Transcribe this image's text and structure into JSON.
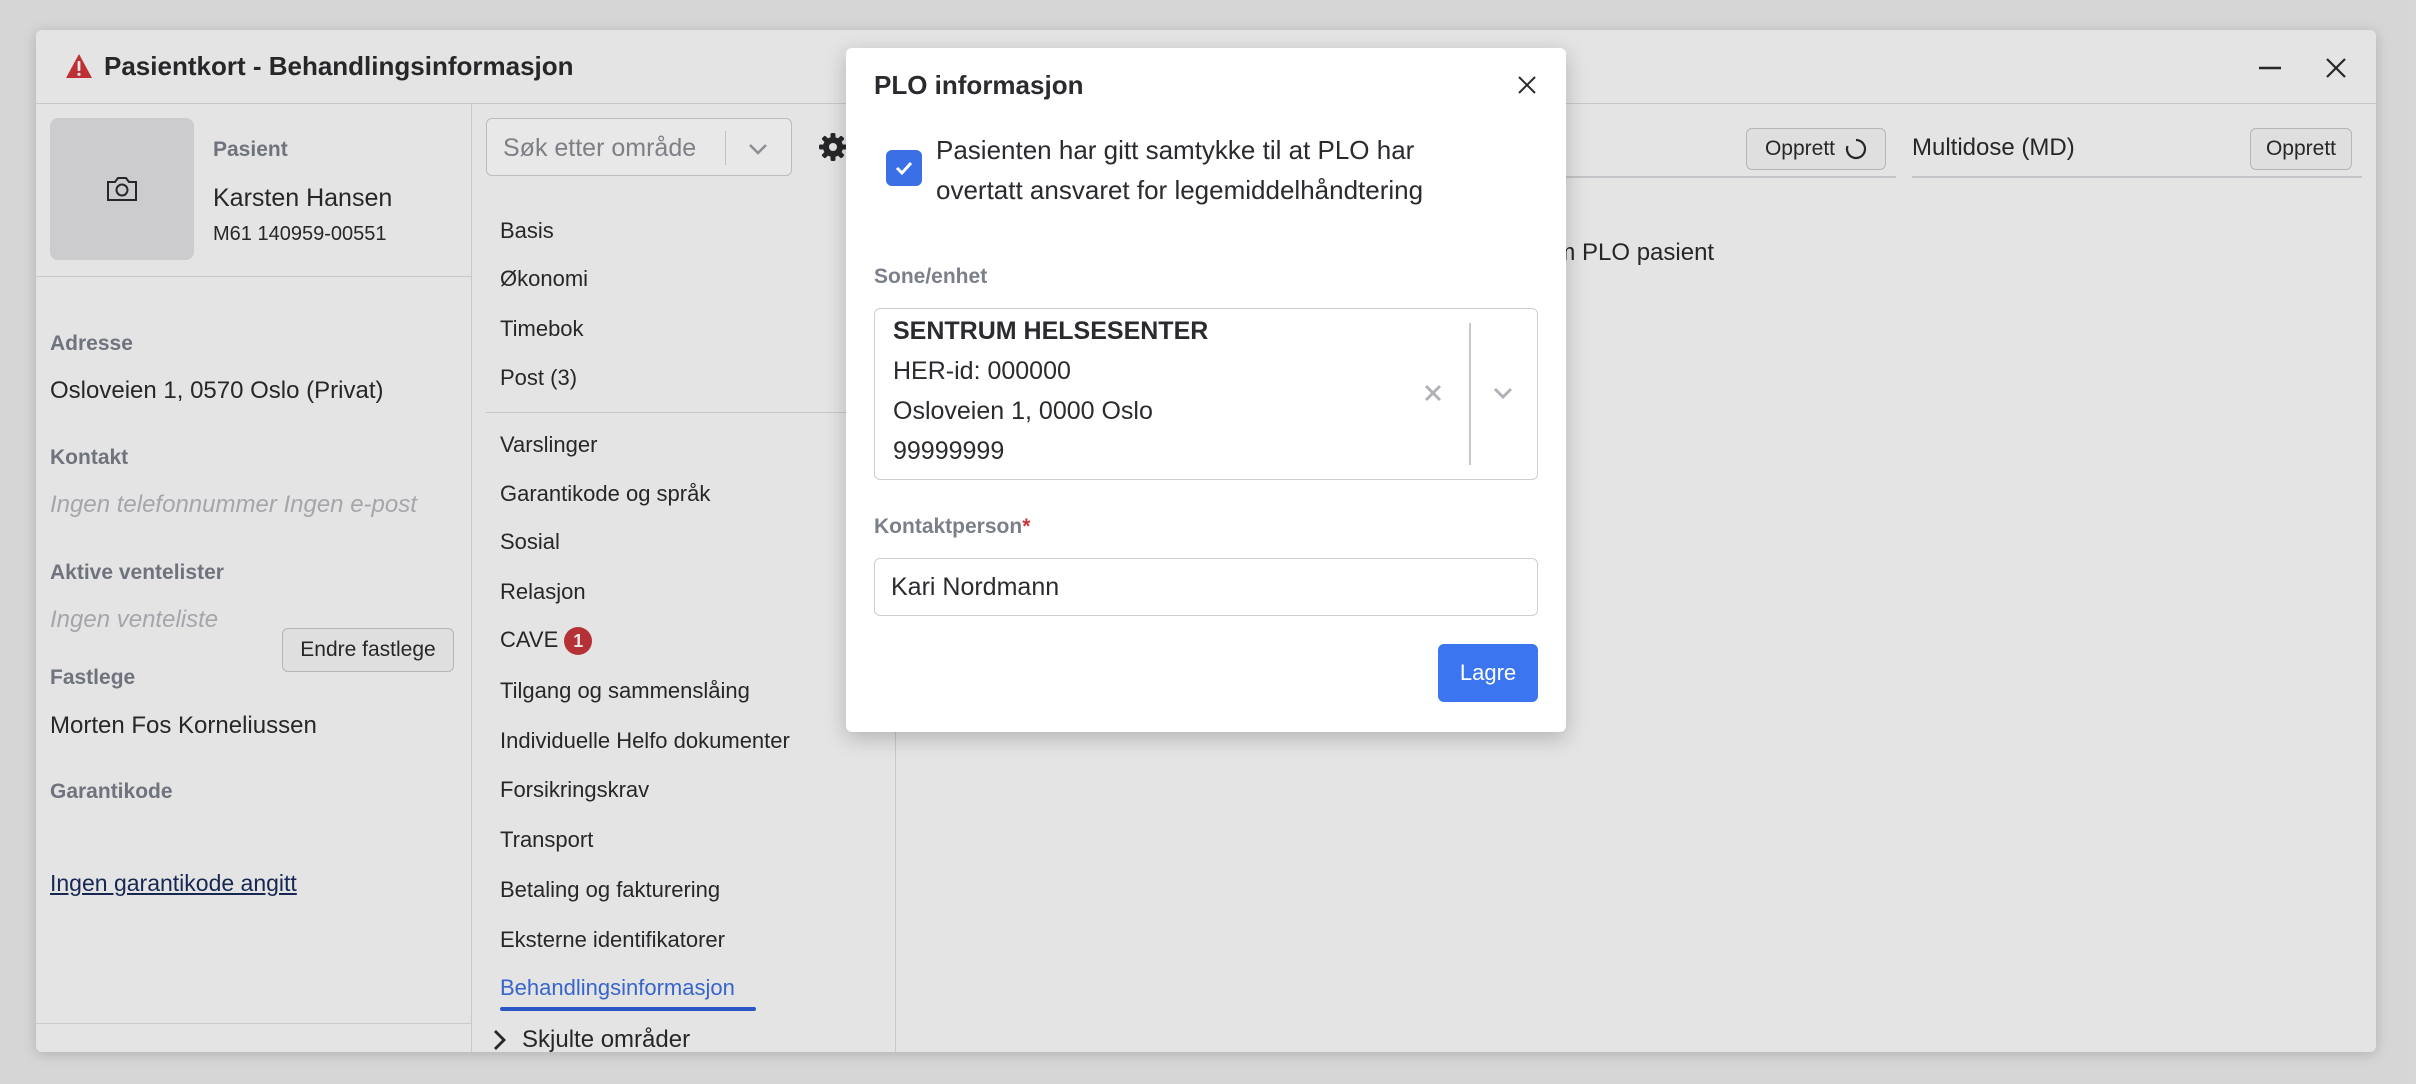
{
  "window": {
    "title": "Pasientkort - Behandlingsinformasjon",
    "title_icon": "warning-triangle-icon",
    "warning_color": "#d0363c"
  },
  "patient": {
    "label": "Pasient",
    "name": "Karsten Hansen",
    "id": "M61 140959-00551",
    "address_label": "Adresse",
    "address": "Osloveien 1, 0570 Oslo (Privat)",
    "contact_label": "Kontakt",
    "contact_empty": "Ingen telefonnummer Ingen e-post",
    "waitlist_label": "Aktive ventelister",
    "waitlist_empty": "Ingen venteliste",
    "gp_label": "Fastlege",
    "gp_change_button": "Endre fastlege",
    "gp_name": "Morten Fos Korneliussen",
    "guarantee_label": "Garantikode",
    "guarantee_link": "Ingen garantikode angitt"
  },
  "nav": {
    "search_placeholder": "Søk etter område",
    "group1": [
      "Basis",
      "Økonomi",
      "Timebok",
      "Post (3)"
    ],
    "group2": [
      "Varslinger",
      "Garantikode og språk",
      "Sosial",
      "Relasjon"
    ],
    "cave_label": "CAVE",
    "cave_badge": "1",
    "group3": [
      "Tilgang og sammenslåing",
      "Individuelle Helfo dokumenter",
      "Forsikringskrav",
      "Transport",
      "Betaling og fakturering",
      "Eksterne identifikatorer"
    ],
    "active": "Behandlingsinformasjon",
    "hidden_label": "Skjulte områder",
    "accent_color": "#2f5fd8"
  },
  "main": {
    "opprett_button": "Opprett",
    "multidose_title": "Multidose (MD)",
    "multidose_button": "Opprett",
    "plo_text": "om PLO pasient"
  },
  "modal": {
    "title": "PLO informasjon",
    "consent_text": "Pasienten har gitt samtykke til at PLO har overtatt ansvaret for legemiddelhåndtering",
    "consent_checked": true,
    "sone_label": "Sone/enhet",
    "sone_name": "SENTRUM HELSESENTER",
    "sone_her": "HER-id: 000000",
    "sone_address": "Osloveien 1, 0000 Oslo",
    "sone_phone": "99999999",
    "contact_label": "Kontaktperson",
    "contact_required": "*",
    "contact_value": "Kari Nordmann",
    "save_button": "Lagre",
    "primary_color": "#3b76f0"
  }
}
